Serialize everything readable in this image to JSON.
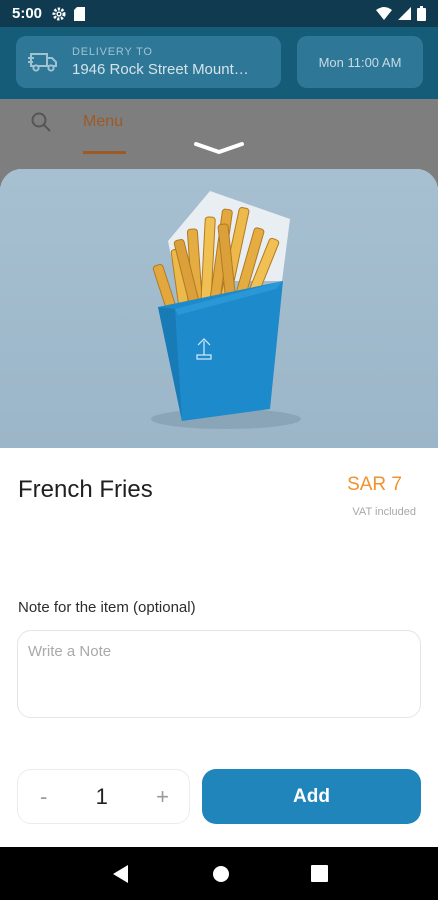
{
  "status_bar": {
    "time": "5:00"
  },
  "header": {
    "delivery_label": "DELIVERY TO",
    "delivery_address": "1946 Rock Street Mount…",
    "delivery_time": "Mon 11:00 AM"
  },
  "tabs": {
    "menu_label": "Menu"
  },
  "item": {
    "name": "French Fries",
    "price": "SAR 7",
    "vat_note": "VAT included"
  },
  "note": {
    "label": "Note for the item (optional)",
    "placeholder": "Write a Note",
    "value": ""
  },
  "order": {
    "minus_label": "-",
    "quantity": "1",
    "plus_label": "+",
    "add_label": "Add"
  },
  "colors": {
    "primary": "#1f85bb",
    "price": "#f0922e",
    "header": "#155c79"
  },
  "icons": {
    "status": [
      "gear-icon",
      "sim-card-icon",
      "wifi-icon",
      "signal-icon",
      "battery-icon"
    ],
    "header": [
      "delivery-truck-icon"
    ],
    "tabs": [
      "search-icon",
      "chevron-down-icon"
    ],
    "nav": [
      "back-icon",
      "home-icon",
      "recents-icon"
    ]
  }
}
